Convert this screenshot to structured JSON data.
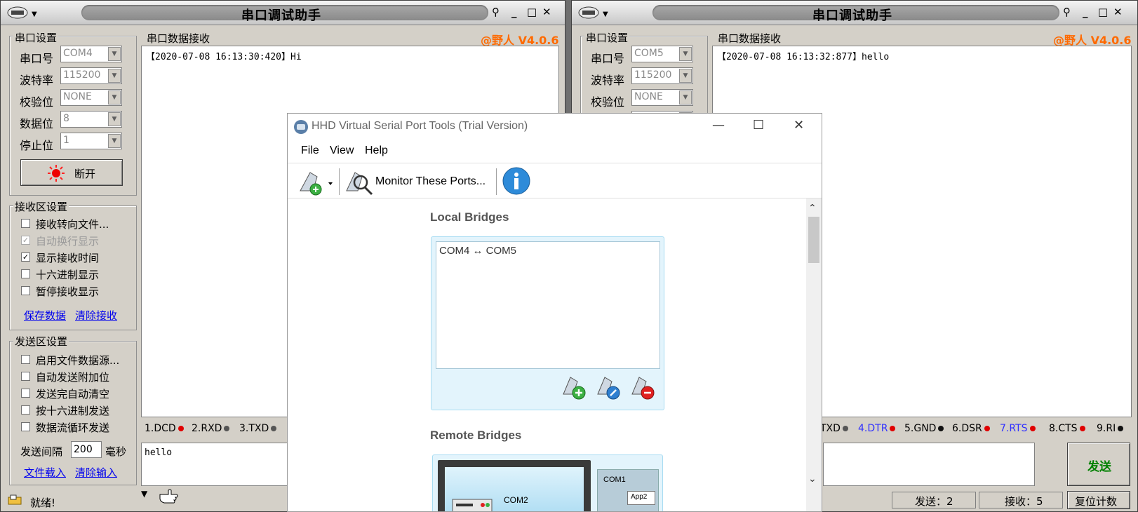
{
  "left_window": {
    "title": "串口调试助手",
    "version": "@野人 V4.0.6",
    "port_settings": {
      "group_label": "串口设置",
      "port_label": "串口号",
      "port_value": "COM4",
      "baud_label": "波特率",
      "baud_value": "115200",
      "parity_label": "校验位",
      "parity_value": "NONE",
      "databits_label": "数据位",
      "databits_value": "8",
      "stopbits_label": "停止位",
      "stopbits_value": "1",
      "open_button": "断开"
    },
    "receive_settings": {
      "group_label": "接收区设置",
      "options": [
        {
          "label": "接收转向文件...",
          "checked": false,
          "disabled": false
        },
        {
          "label": "自动换行显示",
          "checked": true,
          "disabled": true
        },
        {
          "label": "显示接收时间",
          "checked": true,
          "disabled": false
        },
        {
          "label": "十六进制显示",
          "checked": false,
          "disabled": false
        },
        {
          "label": "暂停接收显示",
          "checked": false,
          "disabled": false
        }
      ],
      "save_link": "保存数据",
      "clear_link": "清除接收"
    },
    "send_settings": {
      "group_label": "发送区设置",
      "options": [
        {
          "label": "启用文件数据源...",
          "checked": false
        },
        {
          "label": "自动发送附加位",
          "checked": false
        },
        {
          "label": "发送完自动清空",
          "checked": false
        },
        {
          "label": "按十六进制发送",
          "checked": false
        },
        {
          "label": "数据流循环发送",
          "checked": false
        }
      ],
      "interval_label": "发送间隔",
      "interval_value": "200",
      "interval_unit": "毫秒",
      "load_link": "文件载入",
      "clear_link": "清除输入"
    },
    "receive_area_label": "串口数据接收",
    "received_text": "【2020-07-08 16:13:30:420】Hi",
    "send_text": "hello",
    "signals": [
      "1.DCD",
      "2.RXD",
      "3.TXD"
    ],
    "status": "就绪!"
  },
  "right_window": {
    "title": "串口调试助手",
    "version": "@野人 V4.0.6",
    "port_settings": {
      "group_label": "串口设置",
      "port_label": "串口号",
      "port_value": "COM5",
      "baud_label": "波特率",
      "baud_value": "115200",
      "parity_label": "校验位",
      "parity_value": "NONE"
    },
    "receive_area_label": "串口数据接收",
    "received_text": "【2020-07-08 16:13:32:877】hello",
    "signals": [
      "TXD",
      "4.DTR",
      "5.GND",
      "6.DSR",
      "7.RTS",
      "8.CTS",
      "9.RI"
    ],
    "send_button": "发送",
    "sent_count": "发送：2",
    "recv_count": "接收：5",
    "reset_button": "复位计数"
  },
  "hhd": {
    "title": "HHD Virtual Serial Port Tools (Trial Version)",
    "menu": [
      "File",
      "View",
      "Help"
    ],
    "monitor_button": "Monitor These Ports...",
    "local_bridges_heading": "Local Bridges",
    "bridges": [
      "COM4 ↔ COM5"
    ],
    "remote_bridges_heading": "Remote Bridges",
    "diagram": {
      "com2": "COM2",
      "com1": "COM1",
      "app2": "App2"
    }
  },
  "colors": {
    "accent_orange": "#ff6a00",
    "link_blue": "#0000ee",
    "panel_blue": "#e3f4fc"
  }
}
